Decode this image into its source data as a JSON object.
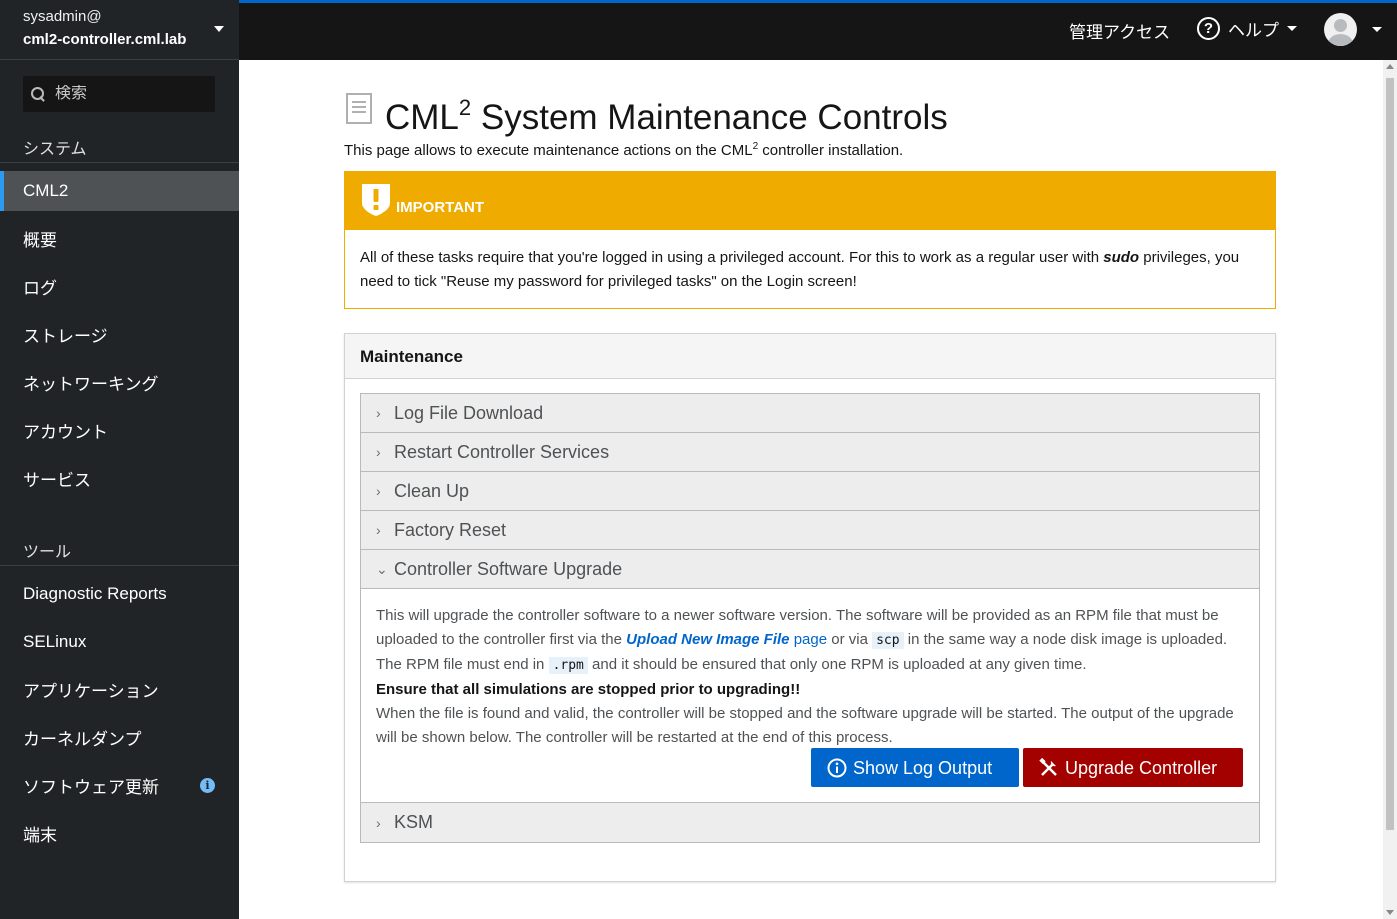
{
  "host": {
    "user": "sysadmin@",
    "name": "cml2-controller.cml.lab"
  },
  "search": {
    "placeholder": "検索"
  },
  "nav": {
    "system_header": "システム",
    "tools_header": "ツール",
    "items": [
      {
        "label": "CML2",
        "active": true
      },
      {
        "label": "概要"
      },
      {
        "label": "ログ"
      },
      {
        "label": "ストレージ"
      },
      {
        "label": "ネットワーキング"
      },
      {
        "label": "アカウント"
      },
      {
        "label": "サービス"
      }
    ],
    "tools": [
      {
        "label": "Diagnostic Reports"
      },
      {
        "label": "SELinux"
      },
      {
        "label": "アプリケーション"
      },
      {
        "label": "カーネルダンプ"
      },
      {
        "label": "ソフトウェア更新",
        "badge": "i"
      },
      {
        "label": "端末"
      }
    ]
  },
  "topbar": {
    "admin_access": "管理アクセス",
    "help": "ヘルプ",
    "help_icon": "?"
  },
  "page": {
    "title_main": "CML",
    "title_sup": "2",
    "title_rest": " System Maintenance Controls",
    "subtitle_pre": "This page allows to execute maintenance actions on the CML",
    "subtitle_sup": "2",
    "subtitle_post": " controller installation."
  },
  "important": {
    "label": "IMPORTANT",
    "text_pre": "All of these tasks require that you're logged in using a privileged account. For this to work as a regular user with ",
    "text_em": "sudo",
    "text_post": " privileges, you need to tick \"Reuse my password for privileged tasks\" on the Login screen!"
  },
  "maintenance": {
    "header": "Maintenance",
    "sections": [
      {
        "label": "Log File Download",
        "expanded": false
      },
      {
        "label": "Restart Controller Services",
        "expanded": false
      },
      {
        "label": "Clean Up",
        "expanded": false
      },
      {
        "label": "Factory Reset",
        "expanded": false
      },
      {
        "label": "Controller Software Upgrade",
        "expanded": true
      },
      {
        "label": "KSM",
        "expanded": false
      }
    ],
    "upgrade": {
      "p1_a": "This will upgrade the controller software to a newer software version. The software will be provided as an RPM file that must be uploaded to the controller first via the ",
      "p1_link": "Upload New Image File",
      "p1_page": " page",
      "p1_b": " or via ",
      "p1_code1": "scp",
      "p1_c": " in the same way a node disk image is uploaded. The RPM file must end in ",
      "p1_code2": ".rpm",
      "p1_d": " and it should be ensured that only one RPM is uploaded at any given time.",
      "warning": "Ensure that all simulations are stopped prior to upgrading!!",
      "p2": "When the file is found and valid, the controller will be stopped and the software upgrade will be started. The output of the upgrade will be shown below. The controller will be restarted at the end of this process.",
      "btn_log": "Show Log Output",
      "btn_upgrade": "Upgrade Controller"
    }
  },
  "colors": {
    "accent": "#0066cc",
    "warning": "#f0ab00",
    "danger": "#a30000",
    "sidebar": "#212427"
  }
}
